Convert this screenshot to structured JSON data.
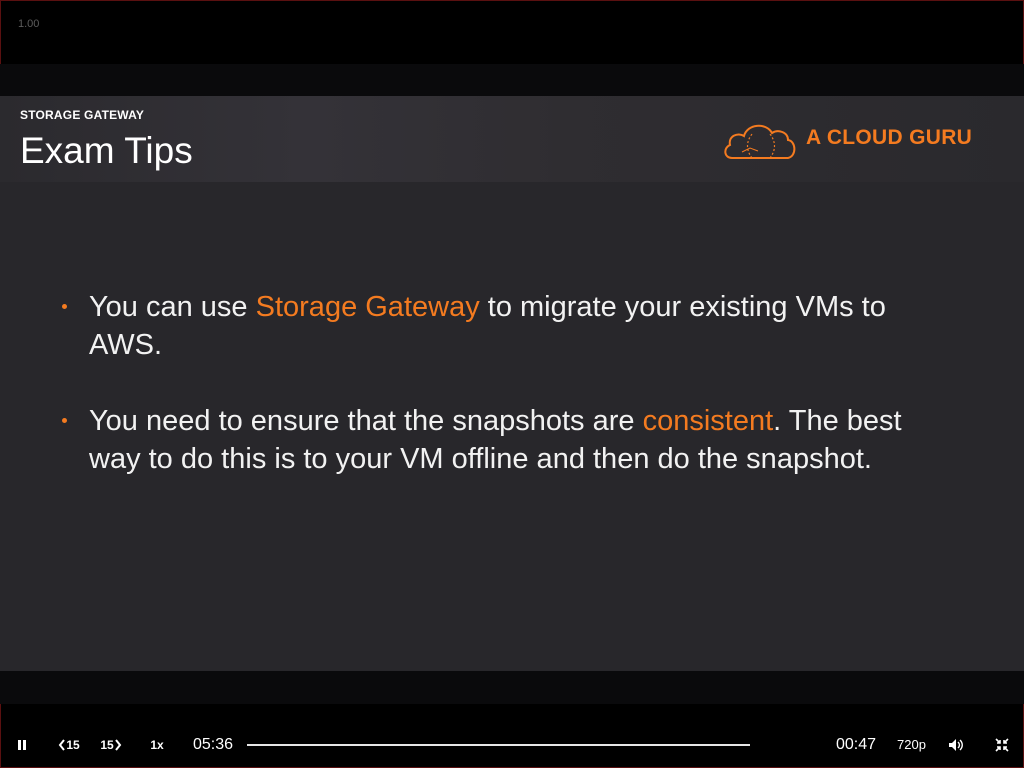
{
  "player": {
    "zoom_readout": "1.00",
    "elapsed": "05:36",
    "remaining": "00:47",
    "speed_label": "1x",
    "rewind_label": "15",
    "forward_label": "15",
    "quality": "720p",
    "progress": 0.0
  },
  "slide": {
    "kicker": "STORAGE GATEWAY",
    "title": "Exam Tips",
    "brand": "A CLOUD GURU",
    "bullets": [
      {
        "before": "You can use ",
        "highlight": "Storage Gateway",
        "after": " to migrate your existing VMs to AWS."
      },
      {
        "before": "You need to ensure that the snapshots are ",
        "highlight": "consistent",
        "after": ". The best way to do this is to your VM offline and then do the snapshot."
      }
    ]
  },
  "icons": {
    "play_pause": "pause-icon",
    "rewind": "rewind-15-icon",
    "forward": "forward-15-icon",
    "volume": "volume-icon",
    "exit_fullscreen": "exit-fullscreen-icon",
    "logo": "cloud-logo-icon"
  },
  "colors": {
    "accent": "#f47b20",
    "slide_bg": "#28272b",
    "player_bg": "#000000"
  }
}
